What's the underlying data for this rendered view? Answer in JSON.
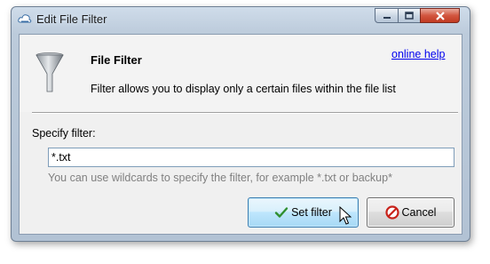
{
  "window": {
    "title": "Edit File Filter"
  },
  "header": {
    "title": "File Filter",
    "help_link": "online help",
    "description": "Filter allows you to display only a certain files within the file list"
  },
  "filter": {
    "label": "Specify filter:",
    "value": "*.txt",
    "hint": "You can use wildcards to specify the filter, for example *.txt or backup*"
  },
  "buttons": {
    "set_filter": "Set filter",
    "cancel": "Cancel"
  },
  "icons": {
    "app": "app-cloud-icon",
    "funnel": "funnel-icon",
    "set_filter": "checkmark-icon",
    "cancel": "no-entry-icon"
  }
}
